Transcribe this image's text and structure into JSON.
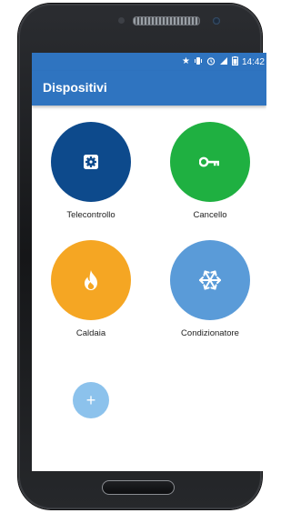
{
  "status_bar": {
    "time": "14:42",
    "icons": [
      "star-icon",
      "vibrate-icon",
      "alarm-icon",
      "signal-icon",
      "battery-icon"
    ]
  },
  "app_bar": {
    "title": "Dispositivi"
  },
  "devices": [
    {
      "label": "Telecontrollo",
      "color": "#0d4a8c",
      "icon": "gear-icon"
    },
    {
      "label": "Cancello",
      "color": "#1fb041",
      "icon": "key-icon"
    },
    {
      "label": "Caldaia",
      "color": "#f5a623",
      "icon": "flame-icon"
    },
    {
      "label": "Condizionatore",
      "color": "#5a9bd8",
      "icon": "snowflake-icon"
    }
  ],
  "fab": {
    "label": "+",
    "color": "#8cc2ec"
  }
}
